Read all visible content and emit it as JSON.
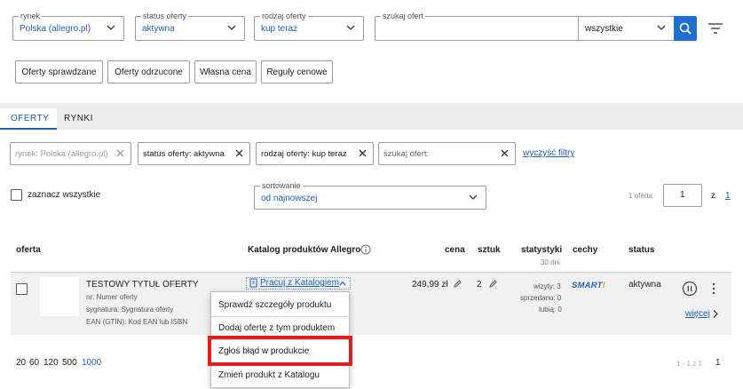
{
  "filters": {
    "market": {
      "legend": "rynek",
      "value": "Polska (allegro.pl)"
    },
    "status": {
      "legend": "status oferty",
      "value": "aktywna"
    },
    "type": {
      "legend": "rodzaj oferty",
      "value": "kup teraz"
    },
    "search": {
      "legend": "szukaj ofert",
      "value": "",
      "scope": "wszystkie"
    }
  },
  "offer_buttons": [
    "Oferty sprawdzane",
    "Oferty odrzucone",
    "Własna cena",
    "Reguły cenowe"
  ],
  "tabs": {
    "offers": "OFERTY",
    "markets": "RYNKI"
  },
  "chips": {
    "market": "rynek: Polska (allegro.pl)",
    "status": "status oferty: aktywna",
    "type": "rodzaj oferty: kup teraz",
    "search": "szukaj ofert:",
    "clear": "wyczyść filtry"
  },
  "select_all": "zaznacz wszystkie",
  "sort": {
    "legend": "sortowanie",
    "value": "od najnowszej"
  },
  "pagination_top": {
    "count": "1 oferta",
    "page": "1",
    "of": "z",
    "total": "1"
  },
  "columns": {
    "offer": "oferta",
    "catalog": "Katalog produktów Allegro",
    "price": "cena",
    "qty": "sztuk",
    "stats": "statystyki",
    "stats_sub": "30 dni",
    "features": "cechy",
    "status": "status"
  },
  "row": {
    "title": "TESTOWY TYTUŁ OFERTY",
    "nr": "nr: Numer oferty",
    "signature": "sygnatura: Sygnatura oferty",
    "ean": "EAN (GTIN): Kod EAN lub ISBN",
    "catalog_link": "Pracuj z Katalogiem",
    "price": "249,99 zł",
    "qty": "2",
    "visits": "wizyty: 3",
    "sold": "sprzedano: 0",
    "likes": "lubią: 0",
    "smart": "SMART!",
    "status": "aktywna",
    "more": "więcej"
  },
  "dropdown": [
    "Sprawdź szczegóły produktu",
    "Dodaj ofertę z tym produktem",
    "Zgłoś błąd w produkcie",
    "Zmień produkt z Katalogu"
  ],
  "page_sizes": [
    "20",
    "60",
    "120",
    "500",
    "1000"
  ],
  "pagination_bottom": {
    "range": "1 - 1 z 1",
    "page": "1"
  },
  "colors": {
    "accent": "#1f5fb0",
    "highlight": "#e02020",
    "smart": "#2c5fb0",
    "smart_bang": "#f08a00"
  }
}
